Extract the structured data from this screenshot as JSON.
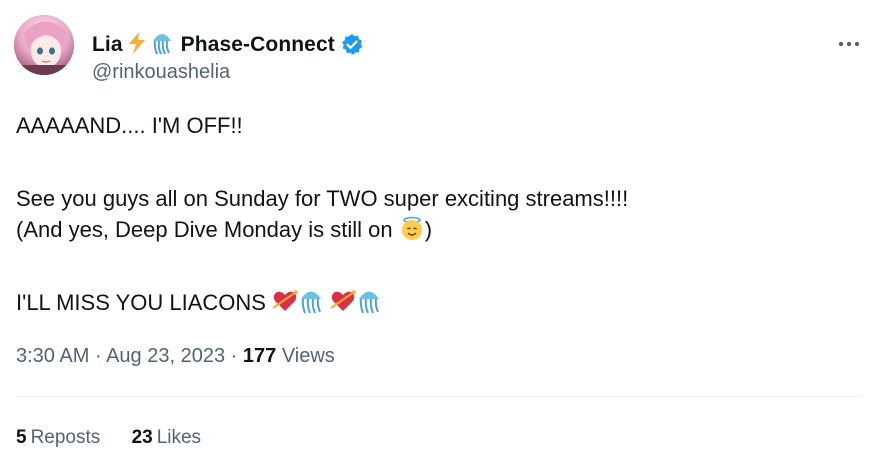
{
  "author": {
    "display_name": "Lia",
    "org": "Phase-Connect",
    "handle": "@rinkouashelia",
    "verified": true
  },
  "tweet": {
    "line1": "AAAAAND.... I'M OFF!!",
    "line2": "See you guys all on Sunday for TWO super exciting streams!!!!",
    "line3_before": "(And yes, Deep Dive Monday is still on ",
    "line3_after": ")",
    "line4": "I'LL MISS YOU LIACONS "
  },
  "meta": {
    "time": "3:30 AM",
    "separator": "·",
    "date": "Aug 23, 2023",
    "views_count": "177",
    "views_label": "Views"
  },
  "stats": {
    "reposts_count": "5",
    "reposts_label": "Reposts",
    "likes_count": "23",
    "likes_label": "Likes"
  },
  "icons": {
    "lightning": "high-voltage-emoji",
    "jellyfish": "jellyfish-emoji",
    "angel": "angel-face-emoji",
    "heart": "heart-with-arrow-emoji",
    "more": "more-dots-icon",
    "verified": "verified-badge-icon"
  },
  "colors": {
    "verified_blue": "#1d9bf0",
    "secondary_text": "#536471",
    "primary_text": "#0f1419"
  }
}
